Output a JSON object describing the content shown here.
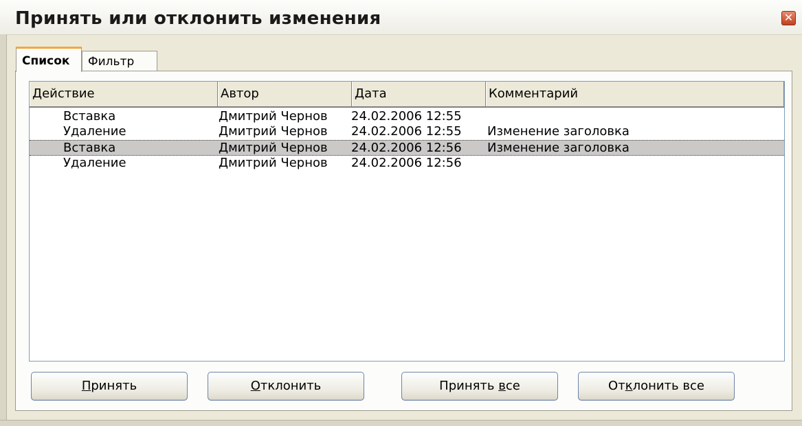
{
  "window": {
    "title": "Принять или отклонить изменения",
    "close_glyph": "✕"
  },
  "tabs": [
    {
      "label": "Список",
      "active": true
    },
    {
      "label": "Фильтр",
      "active": false
    }
  ],
  "table": {
    "columns": [
      "Действие",
      "Автор",
      "Дата",
      "Комментарий"
    ],
    "rows": [
      {
        "action": "Вставка",
        "author": "Дмитрий Чернов",
        "date": "24.02.2006 12:55",
        "comment": "",
        "selected": false
      },
      {
        "action": "Удаление",
        "author": "Дмитрий Чернов",
        "date": "24.02.2006 12:55",
        "comment": "Изменение заголовка",
        "selected": false
      },
      {
        "action": "Вставка",
        "author": "Дмитрий Чернов",
        "date": "24.02.2006 12:56",
        "comment": "Изменение заголовка",
        "selected": true
      },
      {
        "action": "Удаление",
        "author": "Дмитрий Чернов",
        "date": "24.02.2006 12:56",
        "comment": "",
        "selected": false
      }
    ]
  },
  "buttons": {
    "accept": {
      "mnemonic": "П",
      "rest": "ринять"
    },
    "reject": {
      "mnemonic": "О",
      "rest": "тклонить"
    },
    "accept_all": {
      "pre": "Принять ",
      "mnemonic": "в",
      "rest": "се"
    },
    "reject_all": {
      "pre": "От",
      "mnemonic": "к",
      "rest": "лонить все"
    }
  },
  "colors": {
    "window_bg": "#ece9d8",
    "tab_accent": "#f3a63e",
    "selected_row": "#cac9c7",
    "close_button": "#c0401f"
  }
}
